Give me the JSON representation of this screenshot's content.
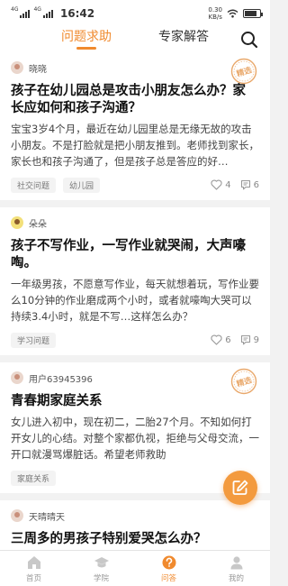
{
  "status_bar": {
    "net1": "4G",
    "net2": "4G",
    "time": "16:42",
    "speed_value": "0.30",
    "speed_unit": "KB/s",
    "battery_percent": 80
  },
  "top_tabs": [
    "问题求助",
    "专家解答"
  ],
  "posts": [
    {
      "user": "晓晓",
      "badge": "精选",
      "title": "孩子在幼儿园总是攻击小朋友怎么办？家长应如何和孩子沟通？",
      "body": "宝宝3岁4个月，最近在幼儿园里总是无缘无故的攻击小朋友。不是打脸就是把小朋友推到。老师找到家长，家长也和孩子沟通了，但是孩子总是答应的好…",
      "tags": [
        "社交问题",
        "幼儿园"
      ],
      "likes": "4",
      "comments": "6"
    },
    {
      "user": "朵朵",
      "badge": "",
      "title": "孩子不写作业，一写作业就哭闹，大声嚎啕。",
      "body": "一年级男孩，不愿意写作业，每天就想着玩，写作业要么10分钟的作业磨成两个小时，或者就嚎啕大哭可以持续3.4小时，就是不写…这样怎么办？",
      "tags": [
        "学习问题"
      ],
      "likes": "6",
      "comments": "9"
    },
    {
      "user": "用户63945396",
      "badge": "精选",
      "title": "青春期家庭关系",
      "body": "女儿进入初中，现在初二，二胎27个月。不知如何打开女儿的心结。对整个家都仇视，拒绝与父母交流，一开口就漫骂爆脏话。希望老师救助",
      "tags": [
        "家庭关系"
      ],
      "likes": "",
      "comments": ""
    },
    {
      "user": "天晴晴天",
      "badge": "",
      "title": "三周多的男孩子特别爱哭怎么办？",
      "body": "",
      "tags": [],
      "likes": "",
      "comments": ""
    }
  ],
  "bottom_nav": [
    "首页",
    "学院",
    "问答",
    "我的"
  ],
  "colors": {
    "accent": "#f08a2e",
    "badge": "#e9a86b"
  }
}
